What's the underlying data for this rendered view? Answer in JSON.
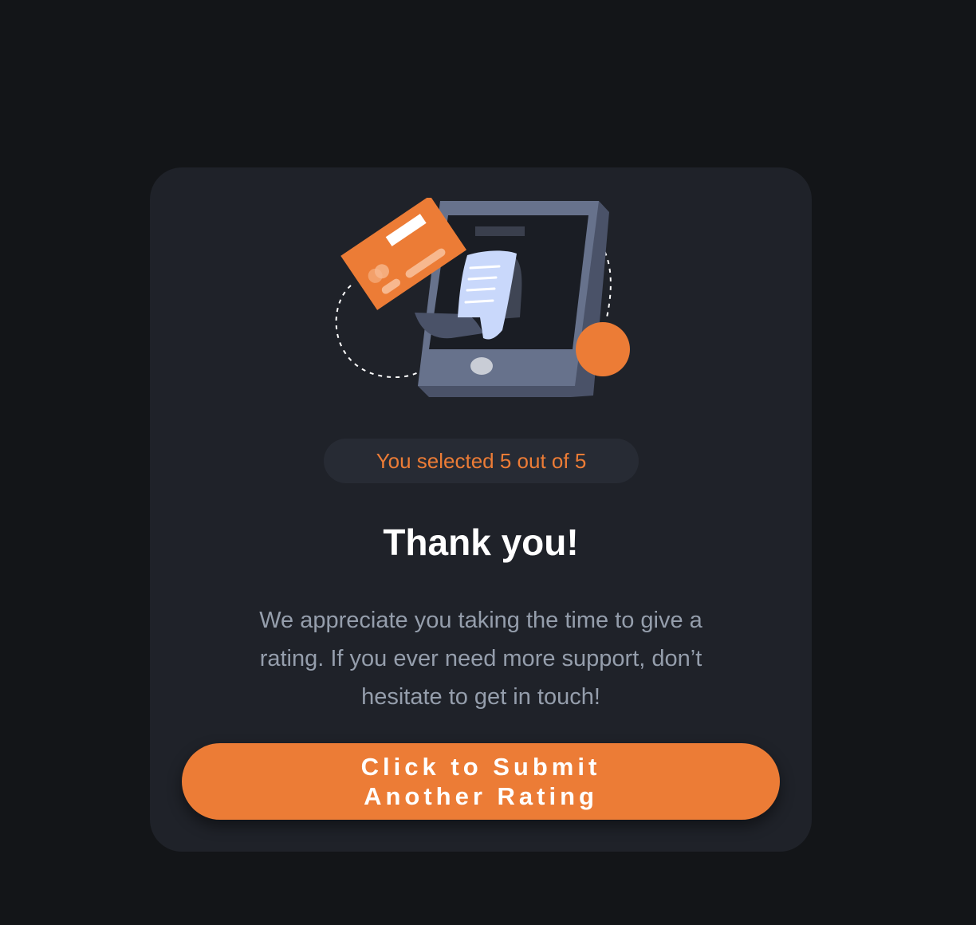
{
  "rating": {
    "selected_text": "You selected 5 out of 5",
    "selected": 5,
    "max": 5
  },
  "thanks": {
    "title": "Thank you!",
    "message": "We appreciate you taking the time to give a rating. If you ever need more support, don’t hesitate to get in touch!"
  },
  "submit_button": {
    "line1": "Click to Submit",
    "line2": "Another Rating"
  },
  "colors": {
    "background": "#131518",
    "card": "#1f2229",
    "accent": "#ec7c36",
    "muted_text": "#959eac",
    "pill_bg": "#272b34"
  },
  "icons": {
    "illustration": "phone-payment-receipt-illustration"
  }
}
